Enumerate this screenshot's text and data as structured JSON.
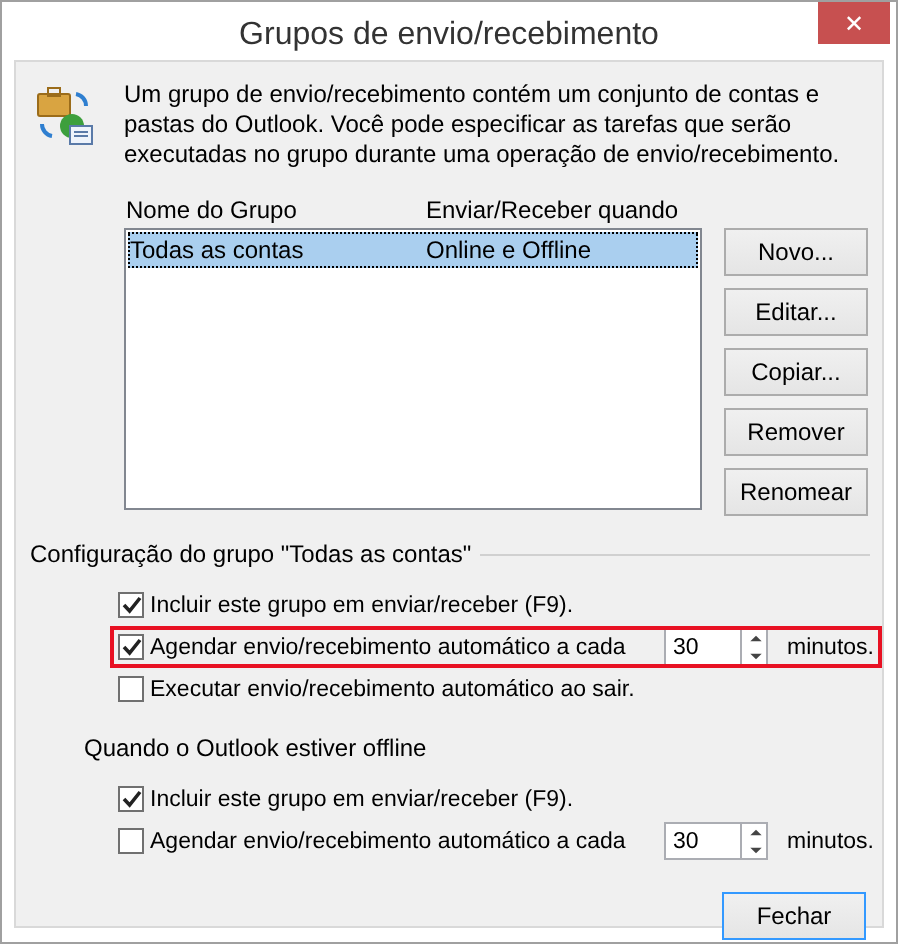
{
  "window": {
    "title": "Grupos de envio/recebimento",
    "close": "✕"
  },
  "description": "Um grupo de envio/recebimento contém um conjunto de contas e pastas do Outlook. Você pode especificar as tarefas que serão executadas no grupo durante uma operação de envio/recebimento.",
  "table": {
    "columns": [
      "Nome do Grupo",
      "Enviar/Receber quando"
    ],
    "rows": [
      {
        "cells": [
          "Todas as contas",
          "Online e Offline"
        ],
        "selected": true
      }
    ]
  },
  "buttons": [
    "Novo...",
    "Editar...",
    "Copiar...",
    "Remover",
    "Renomear"
  ],
  "sections": [
    {
      "title": "Configuração do grupo \"Todas as contas\"",
      "kind": "group",
      "options": [
        {
          "kind": "checkbox",
          "label": "Incluir este grupo em enviar/receber (F9).",
          "checked": true,
          "highlighted": false
        },
        {
          "kind": "interval",
          "label": "Agendar envio/recebimento automático a cada",
          "checked": true,
          "value": "30",
          "unit": "minutos.",
          "highlighted": true
        },
        {
          "kind": "checkbox",
          "label": "Executar envio/recebimento automático ao sair.",
          "checked": false,
          "highlighted": false
        }
      ]
    },
    {
      "title": "Quando o Outlook estiver offline",
      "kind": "sub",
      "options": [
        {
          "kind": "checkbox",
          "label": "Incluir este grupo em enviar/receber (F9).",
          "checked": true,
          "highlighted": false
        },
        {
          "kind": "interval",
          "label": "Agendar envio/recebimento automático a cada",
          "checked": false,
          "value": "30",
          "unit": "minutos.",
          "highlighted": false
        }
      ]
    }
  ],
  "footer_button": "Fechar"
}
